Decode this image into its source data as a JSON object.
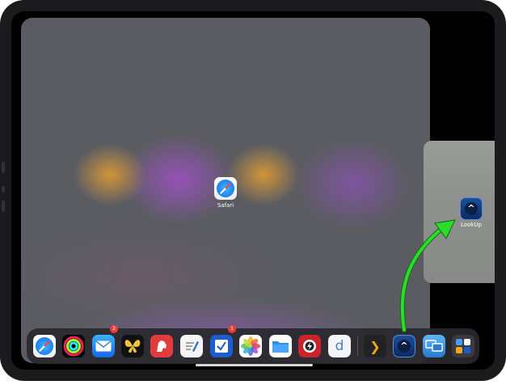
{
  "main_app": {
    "label": "Safari",
    "icon": "safari-compass-icon"
  },
  "slide_over_app": {
    "label": "LookUp",
    "icon": "lookup-chevron-icon",
    "glyph": "^"
  },
  "dock": {
    "apps": [
      {
        "name": "Safari",
        "icon": "safari-icon"
      },
      {
        "name": "Fitness",
        "icon": "activity-rings-icon"
      },
      {
        "name": "Mail",
        "icon": "mail-icon",
        "badge": "2"
      },
      {
        "name": "Tes",
        "icon": "butterfly-icon"
      },
      {
        "name": "Bear",
        "icon": "bear-icon"
      },
      {
        "name": "Notes",
        "icon": "pen-note-icon"
      },
      {
        "name": "Things",
        "icon": "checkbox-icon",
        "badge": "1"
      },
      {
        "name": "Photos",
        "icon": "photos-flower-icon"
      },
      {
        "name": "Files",
        "icon": "folder-icon"
      },
      {
        "name": "Lightning",
        "icon": "bolt-icon"
      },
      {
        "name": "Dict",
        "icon": "letter-d-icon",
        "glyph": "d"
      },
      {
        "name": "Plex",
        "icon": "chevron-right-icon",
        "glyph": "❯"
      },
      {
        "name": "LookUp",
        "icon": "lookup-icon",
        "glyph": "^"
      },
      {
        "name": "Screens",
        "icon": "screens-icon"
      },
      {
        "name": "App Library",
        "icon": "app-library-icon"
      }
    ]
  },
  "colors": {
    "arrow": "#2bdc2b",
    "dock_bg": "#28282e",
    "badge": "#f23b3b"
  }
}
